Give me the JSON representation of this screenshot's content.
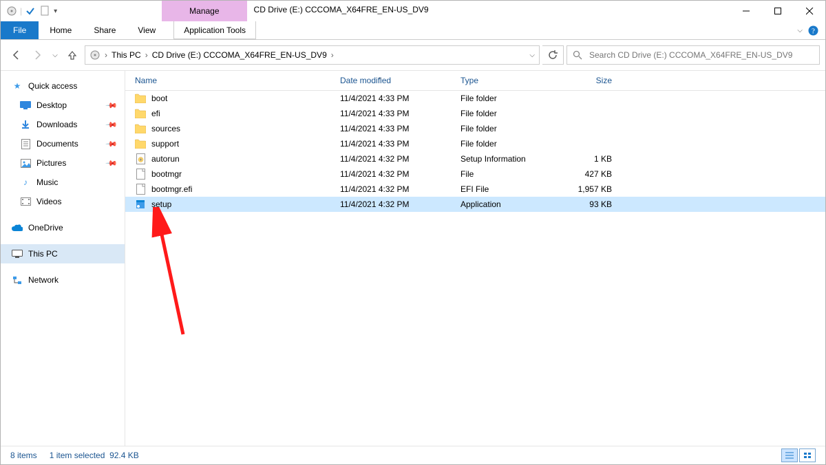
{
  "title": "CD Drive (E:) CCCOMA_X64FRE_EN-US_DV9",
  "ribbon": {
    "manage": "Manage",
    "app_tools": "Application Tools"
  },
  "menu": {
    "file": "File",
    "home": "Home",
    "share": "Share",
    "view": "View"
  },
  "breadcrumb": {
    "root": "This PC",
    "current": "CD Drive (E:) CCCOMA_X64FRE_EN-US_DV9"
  },
  "search": {
    "placeholder": "Search CD Drive (E:) CCCOMA_X64FRE_EN-US_DV9"
  },
  "sidebar": {
    "quick_access": "Quick access",
    "desktop": "Desktop",
    "downloads": "Downloads",
    "documents": "Documents",
    "pictures": "Pictures",
    "music": "Music",
    "videos": "Videos",
    "onedrive": "OneDrive",
    "this_pc": "This PC",
    "network": "Network"
  },
  "columns": {
    "name": "Name",
    "date": "Date modified",
    "type": "Type",
    "size": "Size"
  },
  "files": [
    {
      "icon": "folder",
      "name": "boot",
      "date": "11/4/2021 4:33 PM",
      "type": "File folder",
      "size": ""
    },
    {
      "icon": "folder",
      "name": "efi",
      "date": "11/4/2021 4:33 PM",
      "type": "File folder",
      "size": ""
    },
    {
      "icon": "folder",
      "name": "sources",
      "date": "11/4/2021 4:33 PM",
      "type": "File folder",
      "size": ""
    },
    {
      "icon": "folder",
      "name": "support",
      "date": "11/4/2021 4:33 PM",
      "type": "File folder",
      "size": ""
    },
    {
      "icon": "inf",
      "name": "autorun",
      "date": "11/4/2021 4:32 PM",
      "type": "Setup Information",
      "size": "1 KB"
    },
    {
      "icon": "file",
      "name": "bootmgr",
      "date": "11/4/2021 4:32 PM",
      "type": "File",
      "size": "427 KB"
    },
    {
      "icon": "file",
      "name": "bootmgr.efi",
      "date": "11/4/2021 4:32 PM",
      "type": "EFI File",
      "size": "1,957 KB"
    },
    {
      "icon": "exe",
      "name": "setup",
      "date": "11/4/2021 4:32 PM",
      "type": "Application",
      "size": "93 KB",
      "selected": true
    }
  ],
  "status": {
    "count": "8 items",
    "selection": "1 item selected",
    "size": "92.4 KB"
  }
}
